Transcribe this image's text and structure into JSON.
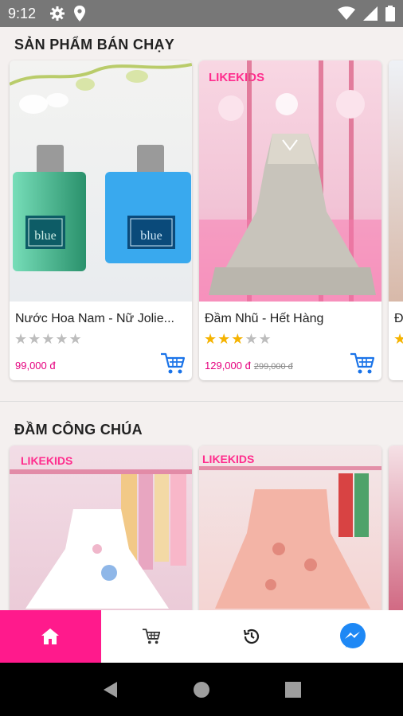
{
  "status_bar": {
    "time": "9:12"
  },
  "sections": [
    {
      "title": "SẢN PHẨM BÁN CHẠY",
      "products": [
        {
          "name": "Nước Hoa Nam - Nữ Jolie...",
          "rating": 0,
          "price": "99,000 đ",
          "old_price": ""
        },
        {
          "name": "Đầm Nhũ - Hết Hàng",
          "rating": 3,
          "price": "129,000 đ",
          "old_price": "299,000 đ"
        },
        {
          "name": "Đ",
          "rating": 1,
          "price": "",
          "old_price": ""
        }
      ]
    },
    {
      "title": "ĐẦM CÔNG CHÚA"
    }
  ],
  "brand_watermark": "LIKEKIDS",
  "bottom_nav": {
    "tabs": [
      {
        "icon": "home-icon",
        "active": true
      },
      {
        "icon": "cart-icon",
        "active": false
      },
      {
        "icon": "history-icon",
        "active": false
      },
      {
        "icon": "messenger-icon",
        "active": false
      }
    ]
  },
  "colors": {
    "accent": "#ff1a8c",
    "price": "#e5007e",
    "star": "#f5b301",
    "cart_icon": "#1a73e8"
  }
}
